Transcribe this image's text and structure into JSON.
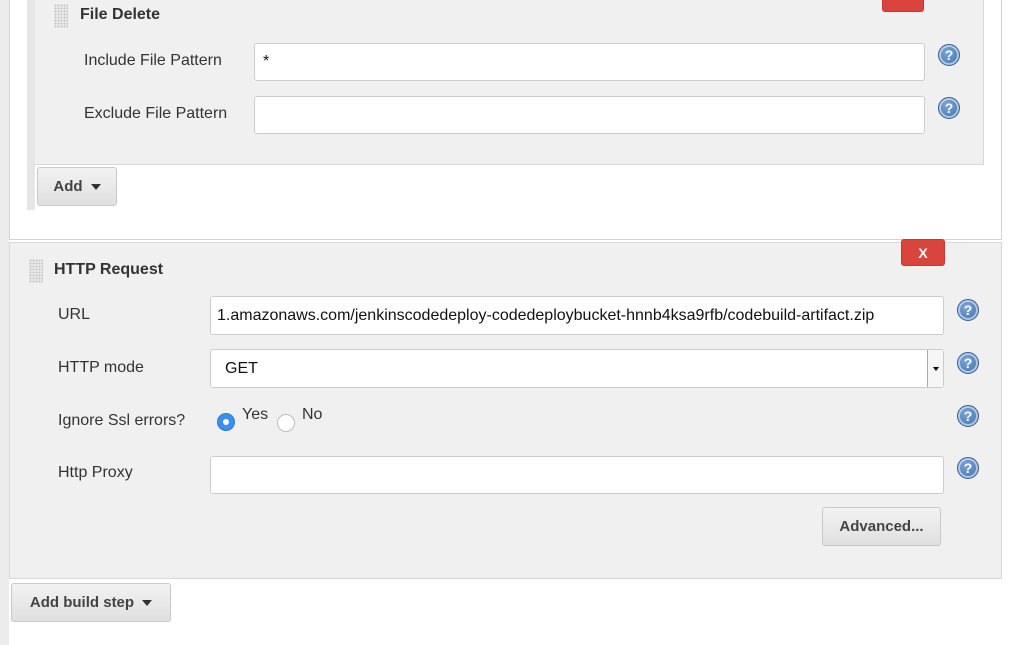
{
  "file_delete": {
    "title": "File Delete",
    "include_label": "Include File Pattern",
    "include_value": "*",
    "exclude_label": "Exclude File Pattern",
    "exclude_value": "",
    "add_button": "Add"
  },
  "http_request": {
    "title": "HTTP Request",
    "delete_label": "X",
    "url_label": "URL",
    "url_value": "1.amazonaws.com/jenkinscodedeploy-codedeploybucket-hnnb4ksa9rfb/codebuild-artifact.zip",
    "mode_label": "HTTP mode",
    "mode_value": "GET",
    "ssl_label": "Ignore Ssl errors?",
    "ssl_options": [
      "Yes",
      "No"
    ],
    "ssl_selected": "Yes",
    "proxy_label": "Http Proxy",
    "proxy_value": "",
    "advanced_button": "Advanced..."
  },
  "add_build_step_button": "Add build step",
  "help_glyph": "?",
  "colors": {
    "delete_red": "#d9453d",
    "help_blue": "#3e6fab",
    "radio_blue": "#3b8ff0",
    "panel_bg": "#f0f0f0"
  }
}
